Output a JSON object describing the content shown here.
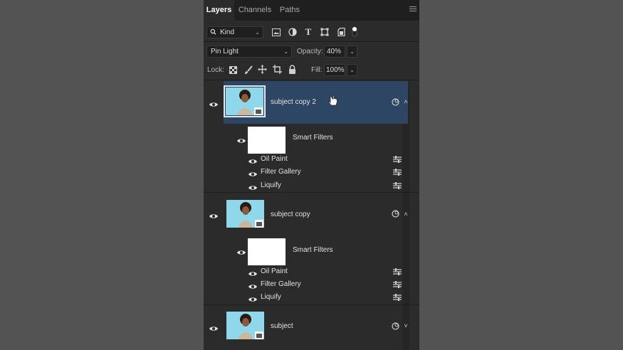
{
  "tabs": [
    {
      "label": "Layers",
      "active": true
    },
    {
      "label": "Channels",
      "active": false
    },
    {
      "label": "Paths",
      "active": false
    }
  ],
  "filter": {
    "kind_label": "Kind",
    "icons": [
      "image-filter-icon",
      "adjustment-filter-icon",
      "type-filter-icon",
      "shape-filter-icon",
      "smart-object-filter-icon",
      "filter-toggle-icon"
    ]
  },
  "blend": {
    "mode": "Pin Light",
    "opacity_label": "Opacity:",
    "opacity_value": "40%"
  },
  "lock": {
    "label": "Lock:",
    "fill_label": "Fill:",
    "fill_value": "100%",
    "icons": [
      "lock-transparent-icon",
      "lock-paint-icon",
      "lock-position-icon",
      "lock-artboard-icon",
      "lock-all-icon"
    ]
  },
  "layers": [
    {
      "name": "subject copy 2",
      "selected": true,
      "expanded": true,
      "smart_filters_label": "Smart Filters",
      "filters": [
        "Oil Paint",
        "Filter Gallery",
        "Liquify"
      ]
    },
    {
      "name": "subject copy",
      "selected": false,
      "expanded": true,
      "smart_filters_label": "Smart Filters",
      "filters": [
        "Oil Paint",
        "Filter Gallery",
        "Liquify"
      ]
    },
    {
      "name": "subject",
      "selected": false,
      "expanded": false
    }
  ],
  "colors": {
    "panel_bg": "#2b2b2b",
    "selected_row": "#2d4663",
    "thumb_bg": "#8fd8ec"
  }
}
